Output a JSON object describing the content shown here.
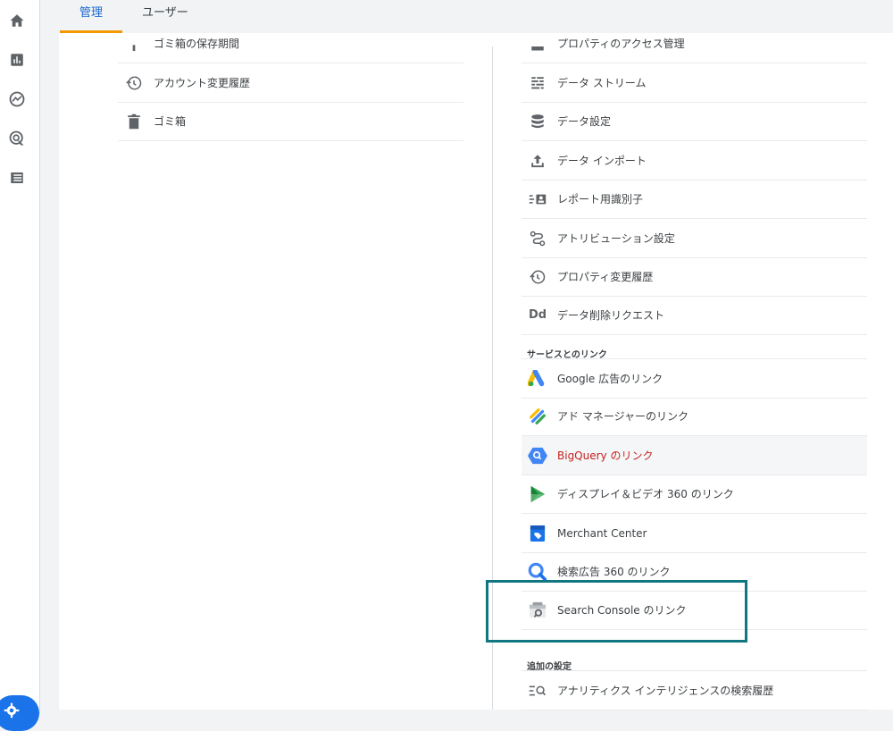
{
  "tabs": [
    {
      "label": "管理"
    },
    {
      "label": "ユーザー"
    }
  ],
  "left_column": {
    "items": [
      {
        "label": "ゴミ箱の保存期間",
        "icon": "partial-icon"
      },
      {
        "label": "アカウント変更履歴",
        "icon": "history-icon"
      },
      {
        "label": "ゴミ箱",
        "icon": "trash-icon"
      }
    ]
  },
  "right_column": {
    "items": [
      {
        "label": "プロパティのアクセス管理",
        "icon": "partial-icon"
      },
      {
        "label": "データ ストリーム",
        "icon": "streams-icon"
      },
      {
        "label": "データ設定",
        "icon": "database-icon"
      },
      {
        "label": "データ インポート",
        "icon": "upload-icon"
      },
      {
        "label": "レポート用識別子",
        "icon": "identity-icon"
      },
      {
        "label": "アトリビューション設定",
        "icon": "attribution-icon"
      },
      {
        "label": "プロパティ変更履歴",
        "icon": "history-icon"
      },
      {
        "label": "データ削除リクエスト",
        "icon": "dd-icon"
      }
    ],
    "dd_glyph": "Dd",
    "links_section_title": "サービスとのリンク",
    "links": [
      {
        "label": "Google 広告のリンク",
        "icon": "google-ads-icon"
      },
      {
        "label": "アド マネージャーのリンク",
        "icon": "ad-manager-icon"
      },
      {
        "label": "BigQuery のリンク",
        "icon": "bigquery-icon"
      },
      {
        "label": "ディスプレイ＆ビデオ 360 のリンク",
        "icon": "dv360-icon"
      },
      {
        "label": "Merchant Center",
        "icon": "merchant-center-icon"
      },
      {
        "label": "検索広告 360 のリンク",
        "icon": "sa360-icon"
      },
      {
        "label": "Search Console のリンク",
        "icon": "search-console-icon"
      }
    ],
    "extra_section_title": "追加の設定",
    "extra": [
      {
        "label": "アナリティクス インテリジェンスの検索履歴",
        "icon": "search-history-icon"
      }
    ]
  },
  "colors": {
    "accent_blue": "#1967d2",
    "tab_underline": "#f29900",
    "bigquery_red": "#c5221f",
    "highlight_teal": "#107682"
  }
}
